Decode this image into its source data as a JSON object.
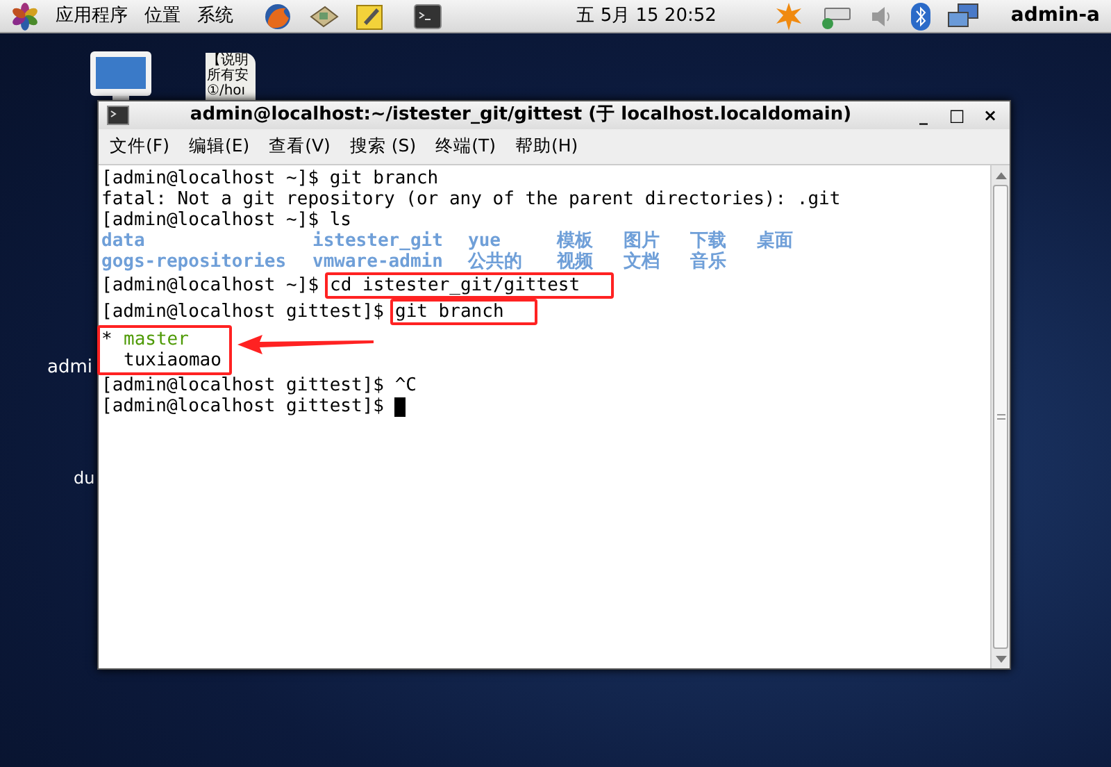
{
  "panel": {
    "menus": [
      "应用程序",
      "位置",
      "系统"
    ],
    "clock": "五 5月 15 20:52",
    "user": "admin-a"
  },
  "desktop": {
    "document_lines": [
      "【说明",
      "所有安",
      "①/hoı"
    ],
    "labels": [
      "admi",
      "du"
    ]
  },
  "window": {
    "title": "admin@localhost:~/istester_git/gittest (于 localhost.localdomain)",
    "controls": [
      "_",
      "□",
      "×"
    ]
  },
  "menu": [
    "文件(F)",
    "编辑(E)",
    "查看(V)",
    "搜索 (S)",
    "终端(T)",
    "帮助(H)"
  ],
  "terminal": {
    "lines": [
      {
        "kind": "text",
        "text": "[admin@localhost ~]$ git branch"
      },
      {
        "kind": "text",
        "text": "fatal: Not a git repository (or any of the parent directories): .git"
      },
      {
        "kind": "text",
        "text": "[admin@localhost ~]$ ls"
      },
      {
        "kind": "listing",
        "cells": [
          "data",
          "istester_git",
          "yue",
          "模板",
          "图片",
          "下载",
          "桌面"
        ]
      },
      {
        "kind": "listing",
        "cells": [
          "gogs-repositories",
          "vmware-admin",
          "公共的",
          "视频",
          "文档",
          "音乐"
        ]
      },
      {
        "kind": "command",
        "prompt": "[admin@localhost ~]$",
        "command": "cd istester_git/gittest",
        "highlighted": true
      },
      {
        "kind": "command",
        "prompt": "[admin@localhost gittest]$",
        "command": "git branch",
        "highlighted": true
      },
      {
        "kind": "branch",
        "marker": "*",
        "text": "master",
        "selected": true
      },
      {
        "kind": "branch",
        "text": "tuxiaomao",
        "selected": false
      },
      {
        "kind": "text",
        "text": "[admin@localhost gittest]$ ^C"
      },
      {
        "kind": "prompt",
        "text": "[admin@localhost gittest]$ "
      }
    ]
  }
}
